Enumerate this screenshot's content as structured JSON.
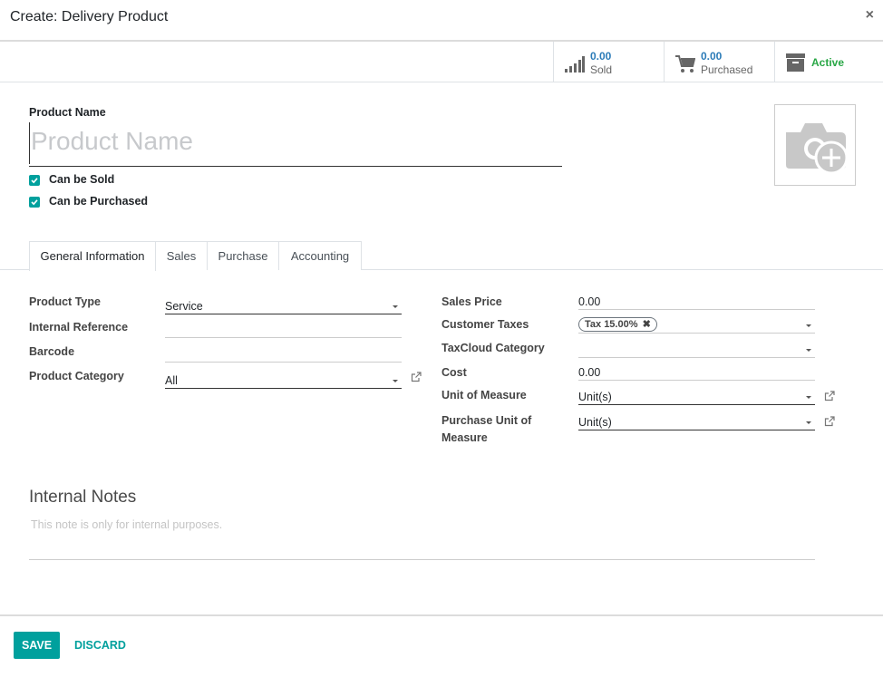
{
  "modal": {
    "title": "Create: Delivery Product",
    "close": "×"
  },
  "stats": {
    "sold": {
      "value": "0.00",
      "label": "Sold"
    },
    "purchased": {
      "value": "0.00",
      "label": "Purchased"
    },
    "active": {
      "label": "Active"
    }
  },
  "product": {
    "name_label": "Product Name",
    "name_placeholder": "Product Name",
    "can_be_sold": {
      "label": "Can be Sold",
      "checked": true
    },
    "can_be_purchased": {
      "label": "Can be Purchased",
      "checked": true
    }
  },
  "tabs": [
    {
      "label": "General Information",
      "active": true
    },
    {
      "label": "Sales",
      "active": false
    },
    {
      "label": "Purchase",
      "active": false
    },
    {
      "label": "Accounting",
      "active": false
    }
  ],
  "left_fields": {
    "product_type": {
      "label": "Product Type",
      "value": "Service"
    },
    "internal_reference": {
      "label": "Internal Reference",
      "value": ""
    },
    "barcode": {
      "label": "Barcode",
      "value": ""
    },
    "product_category": {
      "label": "Product Category",
      "value": "All"
    }
  },
  "right_fields": {
    "sales_price": {
      "label": "Sales Price",
      "value": "0.00"
    },
    "customer_taxes": {
      "label": "Customer Taxes",
      "tag": "Tax 15.00%",
      "tag_remove": "✖"
    },
    "taxcloud_category": {
      "label": "TaxCloud Category",
      "value": ""
    },
    "cost": {
      "label": "Cost",
      "value": "0.00"
    },
    "unit_of_measure": {
      "label": "Unit of Measure",
      "value": "Unit(s)"
    },
    "purchase_uom": {
      "label_line1": "Purchase Unit of",
      "label_line2": "Measure",
      "value": "Unit(s)"
    }
  },
  "notes": {
    "title": "Internal Notes",
    "placeholder": "This note is only for internal purposes."
  },
  "footer": {
    "save": "SAVE",
    "discard": "DISCARD"
  },
  "colors": {
    "primary": "#00a09d",
    "stat_value": "#2c7cb8",
    "active": "#28a745"
  }
}
